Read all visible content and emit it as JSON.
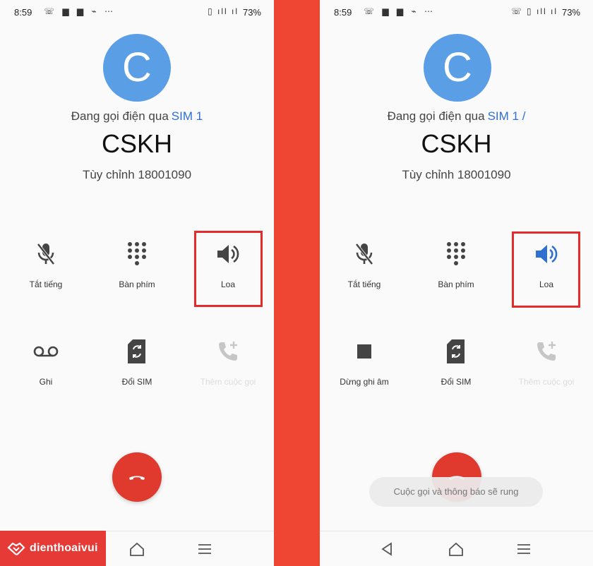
{
  "colors": {
    "accent_blue": "#2f6fd1",
    "avatar_blue": "#5a9ee6",
    "end_call_red": "#e0392d",
    "divider_red": "#ee4632",
    "highlight_red": "#e32b2b"
  },
  "left": {
    "status": {
      "time": "8:59",
      "battery": "73%"
    },
    "avatar_letter": "C",
    "calling_via": "Đang gọi điện qua",
    "sim": "SIM 1",
    "contact_name": "CSKH",
    "contact_number": "Tùy chỉnh 18001090",
    "actions": {
      "mute": "Tắt tiếng",
      "keypad": "Bàn phím",
      "speaker": "Loa",
      "record": "Ghi",
      "switch_sim": "Đổi SIM",
      "add_call": "Thêm cuộc gọi"
    }
  },
  "right": {
    "status": {
      "time": "8:59",
      "battery": "73%"
    },
    "avatar_letter": "C",
    "calling_via": "Đang gọi điện qua",
    "sim": "SIM 1 /",
    "contact_name": "CSKH",
    "contact_number": "Tùy chỉnh 18001090",
    "actions": {
      "mute": "Tắt tiếng",
      "keypad": "Bàn phím",
      "speaker": "Loa",
      "record": "Dừng ghi âm",
      "switch_sim": "Đổi SIM",
      "add_call": "Thêm cuộc gọi"
    },
    "toast": "Cuộc gọi và thông báo sẽ rung"
  },
  "brand": {
    "name": "dienthoaivui"
  },
  "icons": [
    "mic-off-icon",
    "dialpad-icon",
    "speaker-icon",
    "voicemail-icon",
    "sim-swap-icon",
    "add-call-icon",
    "stop-icon",
    "end-call-icon",
    "home-icon",
    "menu-icon",
    "back-icon"
  ]
}
